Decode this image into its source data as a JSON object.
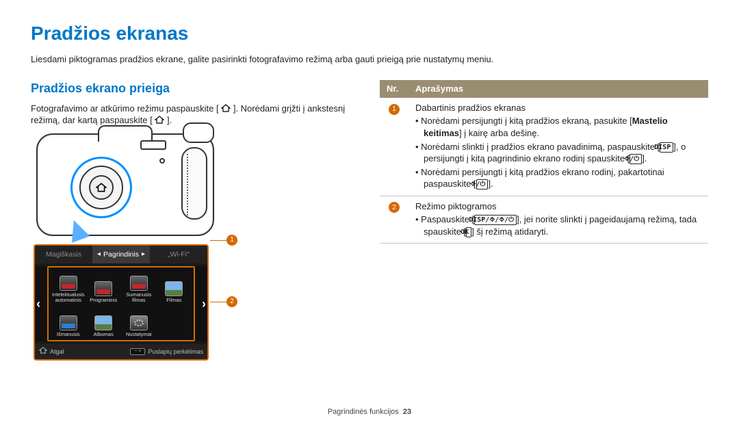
{
  "title": "Pradžios ekranas",
  "intro": "Liesdami piktogramas pradžios ekrane, galite pasirinkti fotografavimo režimą arba gauti prieigą prie nustatymų meniu.",
  "section": {
    "heading": "Pradžios ekrano prieiga",
    "para_a": "Fotografavimo ar atkūrimo režimu paspauskite [",
    "para_b": "]. Norėdami grįžti į ankstesnį režimą, dar kartą paspauskite [",
    "para_c": "]."
  },
  "screen": {
    "tabs": {
      "left": "Magiškasis",
      "center": "Pagrindinis",
      "right": "„Wi-Fi\""
    },
    "apps": [
      {
        "label_a": "Intelektualusis",
        "label_b": "automatinis"
      },
      {
        "label_a": "Programinis",
        "label_b": ""
      },
      {
        "label_a": "Sumanusis",
        "label_b": "filmas"
      },
      {
        "label_a": "Filmas",
        "label_b": ""
      },
      {
        "label_a": "Išmanusis",
        "label_b": ""
      },
      {
        "label_a": "Albumas",
        "label_b": ""
      },
      {
        "label_a": "Nustatymai",
        "label_b": ""
      }
    ],
    "footer": {
      "back": "Atgal",
      "move": "Puslapių perkėlimas"
    }
  },
  "table": {
    "header_nr": "Nr.",
    "header_desc": "Aprašymas",
    "row1": {
      "num": "1",
      "lead": "Dabartinis pradžios ekranas",
      "b1a": "Norėdami persijungti į kitą pradžios ekraną, pasukite [",
      "b1bold": "Mastelio keitimas",
      "b1b": "] į kairę arba dešinę.",
      "b2a": "Norėdami slinkti į pradžios ekrano pavadinimą, paspauskite [",
      "b2disp": "DISP",
      "b2b": "], o persijungti į kitą pagrindinio ekrano rodinį spauskite [",
      "b2sym": "⯑/⏻",
      "b2c": "].",
      "b3a": "Norėdami persijungti į kitą pradžios ekrano rodinį, pakartotinai paspauskite [",
      "b3sym": "⯑/⏻",
      "b3b": "]."
    },
    "row2": {
      "num": "2",
      "lead": "Režimo piktogramos",
      "b1a": "Paspauskite [",
      "b1sym": "DISP/⯑/⯑/⏻",
      "b1b": "], jei norite slinkti į pageidaujamą režimą, tada spauskite [",
      "b1ok": "OK",
      "b1c": "] šį režimą atidaryti."
    }
  },
  "footer": {
    "label": "Pagrindinės funkcijos",
    "page": "23"
  }
}
